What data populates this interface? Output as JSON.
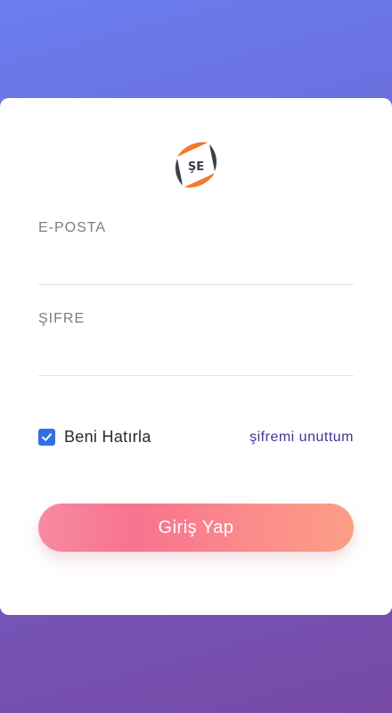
{
  "logo": {
    "icon": "brand-logo-icon",
    "colors": [
      "#f07a2a",
      "#3c3c4a"
    ]
  },
  "form": {
    "email": {
      "label": "E-POSTA",
      "value": "",
      "placeholder": ""
    },
    "password": {
      "label": "ŞIFRE",
      "value": "",
      "placeholder": ""
    }
  },
  "remember_me": {
    "label": "Beni Hatırla",
    "checked": true
  },
  "forgot_password": {
    "label": "şifremi unuttum"
  },
  "submit": {
    "label": "Giriş Yap"
  },
  "colors": {
    "accent": "#2f6fe4",
    "link": "#3e3a8f",
    "button_gradient": [
      "#f7738e",
      "#fd9e86"
    ],
    "background_gradient": [
      "#6a7ef0",
      "#774aa6"
    ]
  }
}
